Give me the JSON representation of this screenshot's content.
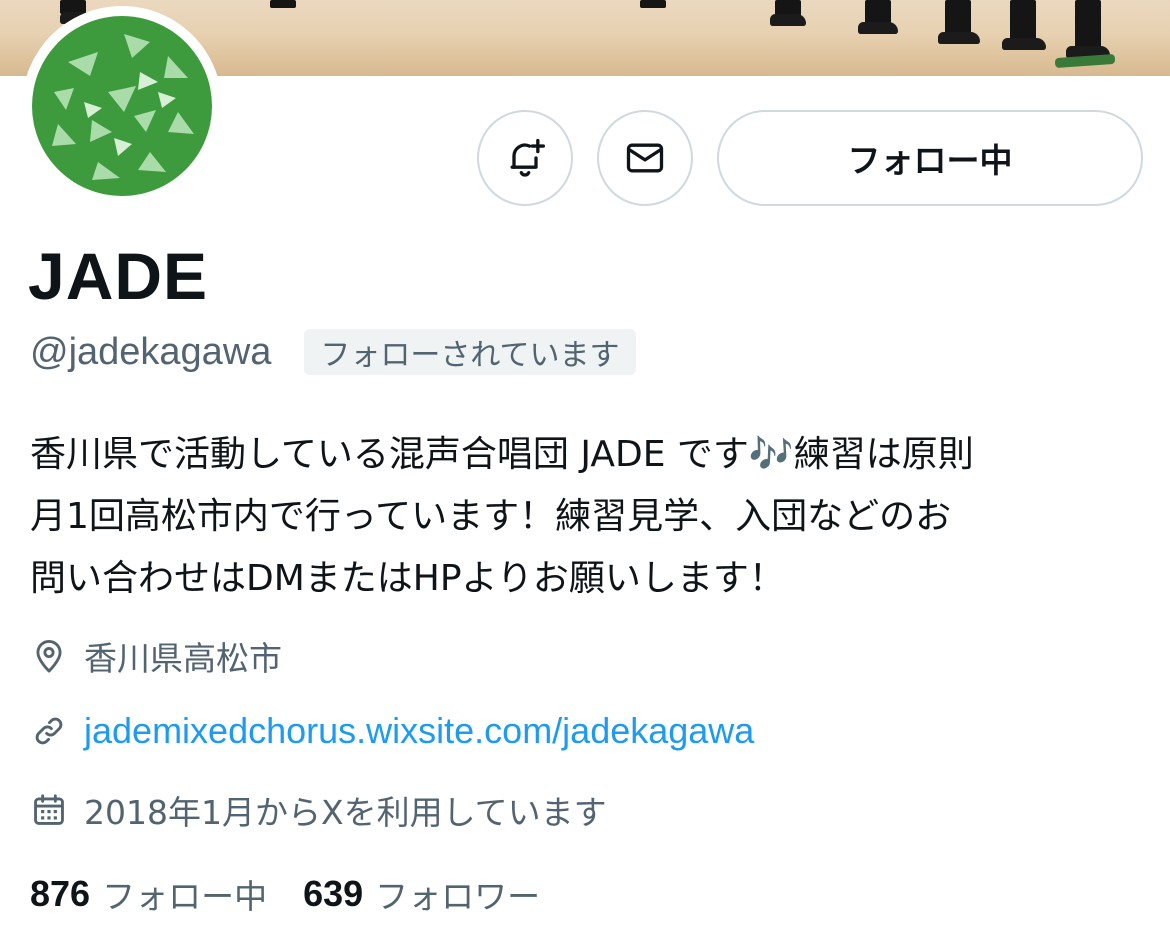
{
  "profile": {
    "display_name": "JADE",
    "handle": "@jadekagawa",
    "follows_you_badge": "フォローされています",
    "bio_lines": [
      "香川県で活動している混声合唱団 JADE です🎶練習は原則",
      "月1回高松市内で行っています！練習見学、入団などのお",
      "問い合わせはDMまたはHPよりお願いします！"
    ],
    "location": "香川県高松市",
    "website": "jademixedchorus.wixsite.com/jadekagawa",
    "joined": "2018年1月からXを利用しています"
  },
  "actions": {
    "follow_label": "フォロー中",
    "notify_icon": "bell-plus-icon",
    "message_icon": "envelope-icon"
  },
  "stats": {
    "following_count": "876",
    "following_label": "フォロー中",
    "followers_count": "639",
    "followers_label": "フォロワー"
  },
  "colors": {
    "text_primary": "#0f1419",
    "text_secondary": "#536471",
    "link": "#1d9bf0",
    "border": "#cfd9de",
    "avatar_green": "#3d9a3d"
  }
}
